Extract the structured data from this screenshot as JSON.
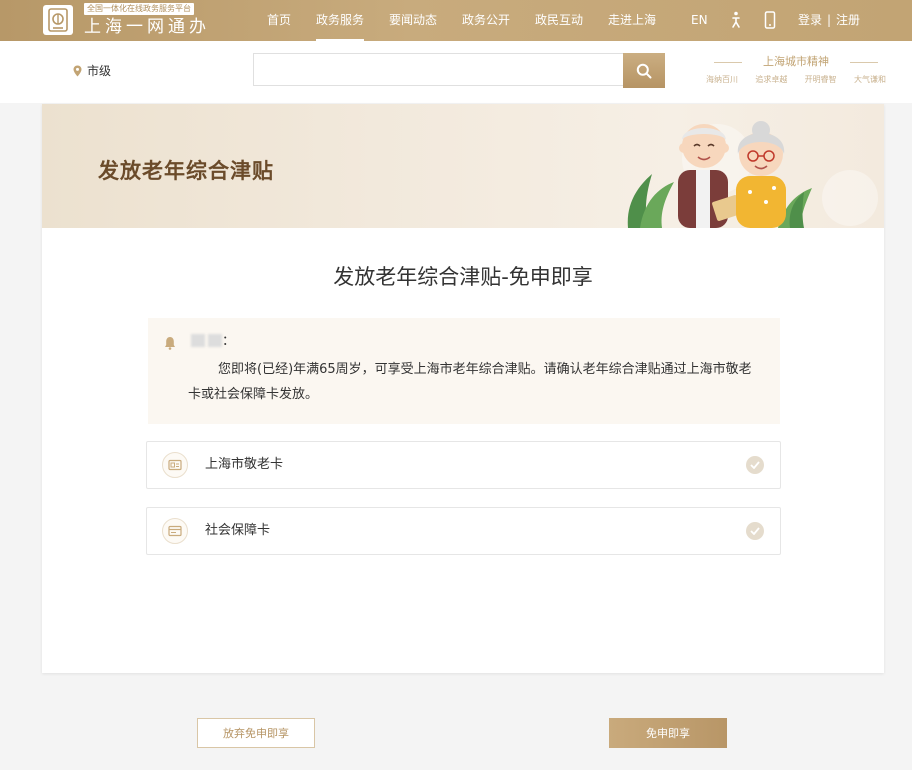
{
  "header": {
    "logo_subtitle": "全国一体化在线政务服务平台",
    "logo_title": "上海一网通办",
    "nav": [
      {
        "label": "首页"
      },
      {
        "label": "政务服务"
      },
      {
        "label": "要闻动态"
      },
      {
        "label": "政务公开"
      },
      {
        "label": "政民互动"
      },
      {
        "label": "走进上海"
      }
    ],
    "lang_label": "EN",
    "login_label": "登录",
    "separator": "|",
    "register_label": "注册",
    "brand_color": "#c2a474"
  },
  "search": {
    "location": "市级",
    "query": "",
    "placeholder": ""
  },
  "city_spirit": {
    "title": "上海城市精神",
    "items": [
      "海纳百川",
      "追求卓越",
      "开明睿智",
      "大气谦和"
    ]
  },
  "banner": {
    "title": "发放老年综合津贴"
  },
  "main": {
    "heading": "发放老年综合津贴-免申即享",
    "notice": {
      "name_suffix": "：",
      "body": "您即将(已经)年满65周岁，可享受上海市老年综合津贴。请确认老年综合津贴通过上海市敬老卡或社会保障卡发放。"
    },
    "options": [
      {
        "label": "上海市敬老卡",
        "icon": "card-icon"
      },
      {
        "label": "社会保障卡",
        "icon": "id-card-icon"
      }
    ]
  },
  "actions": {
    "give_up_label": "放弃免申即享",
    "confirm_label": "免申即享"
  }
}
